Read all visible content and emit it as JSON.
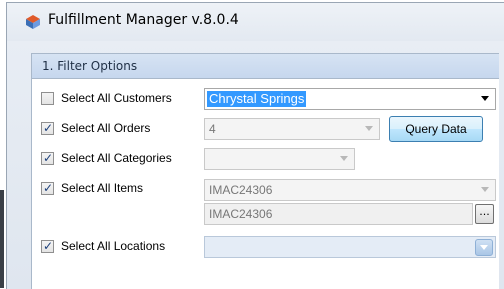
{
  "window": {
    "title": "Fulfillment Manager v.8.0.4"
  },
  "panel": {
    "header": "1. Filter Options"
  },
  "rows": {
    "customers": {
      "label": "Select All Customers",
      "checked": false,
      "value": "Chrystal Springs"
    },
    "orders": {
      "label": "Select All Orders",
      "checked": true,
      "value": "4",
      "button": "Query Data"
    },
    "categories": {
      "label": "Select All Categories",
      "checked": true,
      "value": ""
    },
    "items": {
      "label": "Select All Items",
      "checked": true,
      "value": "IMAC24306",
      "value2": "IMAC24306",
      "ellipsis": "..."
    },
    "locations": {
      "label": "Select All Locations",
      "checked": true,
      "value": ""
    }
  },
  "icons": {
    "app": "fulfillment-app-icon",
    "check": "checkmark-icon",
    "dropdown": "chevron-down-icon"
  }
}
